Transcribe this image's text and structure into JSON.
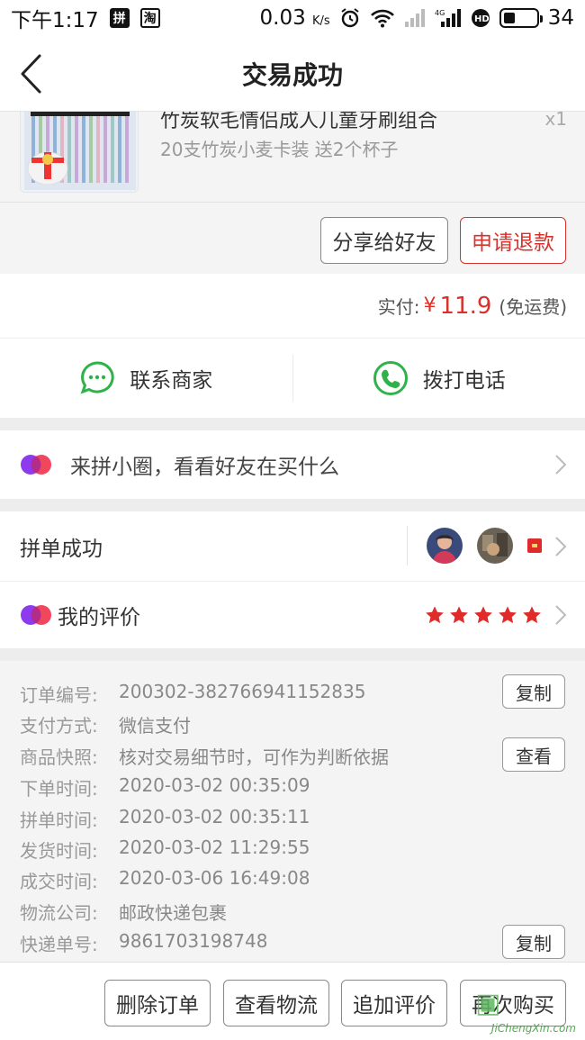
{
  "status_bar": {
    "time": "下午1:17",
    "app_icons": [
      "拼",
      "淘"
    ],
    "net_speed": "0.03",
    "net_unit": "K/s",
    "battery": "34",
    "battery_level": 0.34
  },
  "header": {
    "title": "交易成功"
  },
  "product": {
    "title": "竹炭软毛情侣成人儿童牙刷组合",
    "sku": "20支竹炭小麦卡装 送2个杯子",
    "qty": "x1"
  },
  "actions": {
    "share": "分享给好友",
    "refund": "申请退款"
  },
  "payment": {
    "label": "实付:",
    "symbol": "¥",
    "amount": "11.9",
    "note": "(免运费)"
  },
  "contact": {
    "merchant": "联系商家",
    "phone": "拨打电话"
  },
  "circle": {
    "text": "来拼小圈，看看好友在买什么"
  },
  "group": {
    "text": "拼单成功"
  },
  "review": {
    "text": "我的评价",
    "stars": 5
  },
  "order_info": {
    "rows": [
      {
        "label": "订单编号:",
        "value": "200302-382766941152835"
      },
      {
        "label": "支付方式:",
        "value": "微信支付"
      },
      {
        "label": "商品快照:",
        "value": "核对交易细节时，可作为判断依据"
      },
      {
        "label": "下单时间:",
        "value": "2020-03-02 00:35:09"
      },
      {
        "label": "拼单时间:",
        "value": "2020-03-02 00:35:11"
      },
      {
        "label": "发货时间:",
        "value": "2020-03-02 11:29:55"
      },
      {
        "label": "成交时间:",
        "value": "2020-03-06 16:49:08"
      },
      {
        "label": "物流公司:",
        "value": "邮政快递包裹"
      },
      {
        "label": "快递单号:",
        "value": "9861703198748"
      }
    ],
    "copy_label": "复制",
    "view_label": "查看"
  },
  "bottom": {
    "delete": "删除订单",
    "logistics": "查看物流",
    "add_review": "追加评价",
    "rebuy": "再次购买"
  },
  "watermark": {
    "text": "JiChengXin.com"
  },
  "colors": {
    "accent": "#d8322c",
    "green": "#2fb24a",
    "star": "#e02b2b"
  }
}
